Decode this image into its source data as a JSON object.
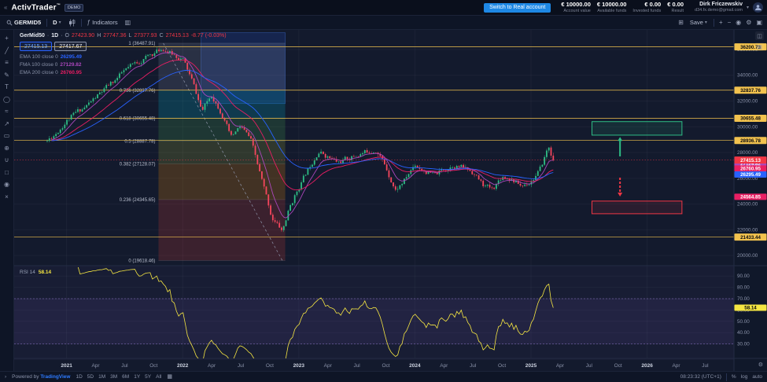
{
  "header": {
    "logo": "ActivTrader",
    "tm": "™",
    "demo_badge": "DEMO",
    "switch_button": "Switch to Real account",
    "metrics": [
      {
        "value": "€ 10000.00",
        "label": "Account value"
      },
      {
        "value": "€ 10000.00",
        "label": "Available funds"
      },
      {
        "value": "€ 0.00",
        "label": "Invested funds"
      },
      {
        "value": "€ 0.00",
        "label": "Result"
      }
    ],
    "user": {
      "name": "Dirk Friczewskiv",
      "detail": "d34.fx.demo@gmail.com"
    }
  },
  "toolbar": {
    "symbol": "GERMID5",
    "interval": "D",
    "indicators_label": "Indicators",
    "save_label": "Save"
  },
  "icons": {
    "chevrons_left": "«",
    "chevron_right": "›",
    "caret": "▾",
    "fx": "ƒ",
    "grid": "▥",
    "layout": "⊞",
    "zoom_in": "+",
    "zoom_out": "−",
    "camera": "◉",
    "settings": "⚙",
    "fullscreen": "▣",
    "calendar": "▦",
    "panel1": "◫",
    "panel2": "▤"
  },
  "drawing_tools": [
    {
      "name": "crosshair-tool",
      "glyph": "+"
    },
    {
      "name": "trendline-tool",
      "glyph": "╱"
    },
    {
      "name": "fib-retracement-tool",
      "glyph": "≡"
    },
    {
      "name": "brush-tool",
      "glyph": "✎"
    },
    {
      "name": "text-tool",
      "glyph": "T"
    },
    {
      "name": "shapes-tool",
      "glyph": "◯"
    },
    {
      "name": "pattern-tool",
      "glyph": "≈"
    },
    {
      "name": "forecast-tool",
      "glyph": "↗"
    },
    {
      "name": "measure-tool",
      "glyph": "▭"
    },
    {
      "name": "zoom-tool",
      "glyph": "⊕"
    },
    {
      "name": "magnet-tool",
      "glyph": "∪"
    },
    {
      "name": "lock-tool",
      "glyph": "□"
    },
    {
      "name": "eye-tool",
      "glyph": "◉"
    },
    {
      "name": "trash-tool",
      "glyph": "×"
    }
  ],
  "legend": {
    "symbol": "GerMid50",
    "sep": "·",
    "interval": "1D",
    "o_label": "O",
    "o": "27423.90",
    "h_label": "H",
    "h": "27747.36",
    "l_label": "L",
    "l": "27377.93",
    "c_label": "C",
    "c": "27415.13",
    "change": "-8.77 (-0.03%)"
  },
  "quotes": {
    "sell": "27415.13",
    "buy": "27417.67"
  },
  "ma_legend": [
    {
      "label": "EMA 100 close 0",
      "value": "26295.49",
      "color": "#2962ff"
    },
    {
      "label": "FMA 100 close 0",
      "value": "27129.82",
      "color": "#ab47bc"
    },
    {
      "label": "EMA 200 close 0",
      "value": "26760.95",
      "color": "#e91e63"
    }
  ],
  "rsi_legend": {
    "label": "RSI 14",
    "value": "58.14"
  },
  "bottom": {
    "powered_prefix": "Powered by",
    "powered_brand": "TradingView",
    "ranges": [
      "1D",
      "5D",
      "1M",
      "3M",
      "6M",
      "1Y",
      "5Y",
      "All"
    ],
    "clock": "08:23:32 (UTC+1)",
    "percent": "%",
    "log": "log",
    "auto": "auto"
  },
  "chart_data": {
    "type": "candlestick",
    "symbol": "GerMid50",
    "interval": "1D",
    "price_axis": {
      "min": 19400,
      "max": 37400,
      "ticks": [
        36000,
        34000,
        32000,
        30000,
        28000,
        26000,
        24000,
        22000,
        20000
      ]
    },
    "time_ticks": [
      {
        "label": "2021",
        "m": 2,
        "year": true
      },
      {
        "label": "Apr",
        "m": 5
      },
      {
        "label": "Jul",
        "m": 8
      },
      {
        "label": "Oct",
        "m": 11
      },
      {
        "label": "2022",
        "m": 14,
        "year": true
      },
      {
        "label": "Apr",
        "m": 17
      },
      {
        "label": "Jul",
        "m": 20
      },
      {
        "label": "Oct",
        "m": 23
      },
      {
        "label": "2023",
        "m": 26,
        "year": true
      },
      {
        "label": "Apr",
        "m": 29
      },
      {
        "label": "Jul",
        "m": 32
      },
      {
        "label": "Oct",
        "m": 35
      },
      {
        "label": "2024",
        "m": 38,
        "year": true
      },
      {
        "label": "Apr",
        "m": 41
      },
      {
        "label": "Jul",
        "m": 44
      },
      {
        "label": "Oct",
        "m": 47
      },
      {
        "label": "2025",
        "m": 50,
        "year": true
      },
      {
        "label": "Apr",
        "m": 53
      },
      {
        "label": "Jul",
        "m": 56
      },
      {
        "label": "Oct",
        "m": 59
      },
      {
        "label": "2026",
        "m": 62,
        "year": true
      },
      {
        "label": "Apr",
        "m": 65
      },
      {
        "label": "Jul",
        "m": 68
      }
    ],
    "anchors": [
      [
        0,
        28900
      ],
      [
        1,
        29600
      ],
      [
        2,
        30500
      ],
      [
        4,
        31600
      ],
      [
        6,
        32900
      ],
      [
        8,
        34300
      ],
      [
        10,
        35300
      ],
      [
        12,
        36100
      ],
      [
        13,
        35600
      ],
      [
        14,
        35300
      ],
      [
        15,
        33500
      ],
      [
        16,
        31200
      ],
      [
        17,
        32500
      ],
      [
        18,
        31200
      ],
      [
        19,
        29100
      ],
      [
        20,
        30000
      ],
      [
        21,
        29000
      ],
      [
        22,
        26300
      ],
      [
        23.2,
        23000
      ],
      [
        24.3,
        21900
      ],
      [
        25,
        23600
      ],
      [
        26,
        25300
      ],
      [
        28,
        28200
      ],
      [
        30,
        27200
      ],
      [
        32,
        27800
      ],
      [
        34,
        28300
      ],
      [
        35,
        26900
      ],
      [
        36,
        25100
      ],
      [
        37,
        25900
      ],
      [
        38,
        27100
      ],
      [
        40,
        26200
      ],
      [
        42,
        27100
      ],
      [
        44,
        26500
      ],
      [
        45,
        25500
      ],
      [
        46,
        25100
      ],
      [
        47,
        26200
      ],
      [
        48,
        26000
      ],
      [
        49,
        25400
      ],
      [
        50,
        25800
      ],
      [
        51,
        26700
      ],
      [
        51.8,
        28500
      ],
      [
        52.3,
        27415.13
      ]
    ],
    "candles": {
      "count": 232,
      "end_m": 52.3,
      "seed": 11
    },
    "up_color": "#2ebd85",
    "down_color": "#f6465d",
    "moving_averages": [
      {
        "name": "FMA",
        "span": 8,
        "color": "#ab47bc"
      },
      {
        "name": "EMA 200",
        "span": 24,
        "color": "#e91e63"
      },
      {
        "name": "EMA 100",
        "span": 44,
        "color": "#2962ff"
      }
    ],
    "current_price": {
      "value": 27415.13,
      "color": "#f23645"
    },
    "ma_badges": [
      {
        "value": 27129.82,
        "color": "#ab47bc"
      },
      {
        "value": 26760.95,
        "color": "#e91e63"
      },
      {
        "value": 26295.49,
        "color": "#2962ff"
      }
    ],
    "hlines": {
      "color": "#f2c24e",
      "values": [
        36200.73,
        32837.76,
        30655.48,
        28936.78,
        21433.44
      ]
    },
    "fib": {
      "m1": 11.5,
      "m2": 24.6,
      "trend_from": {
        "m": 12,
        "price": 36487.91
      },
      "trend_to": {
        "m": 24.3,
        "price": 19618.46
      },
      "levels": [
        {
          "ratio": "1",
          "price": 36487.91,
          "label": "1 (36487.91)"
        },
        {
          "ratio": "0.786",
          "price": 32837.76,
          "label": "0.786 (32837.76)"
        },
        {
          "ratio": "0.618",
          "price": 30655.48,
          "label": "0.618 (30655.48)"
        },
        {
          "ratio": "0.5",
          "price": 28887.78,
          "label": "0.5 (28887.78)"
        },
        {
          "ratio": "0.382",
          "price": 27128.07,
          "label": "0.382 (27128.07)"
        },
        {
          "ratio": "0.236",
          "price": 24345.65,
          "label": "0.236 (24345.65)"
        },
        {
          "ratio": "0",
          "price": 19618.46,
          "label": "0 (19618.46)"
        }
      ],
      "band_colors": [
        "rgba(159,168,190,0.16)",
        "rgba(0,188,212,0.20)",
        "rgba(76,175,80,0.20)",
        "rgba(205,220,57,0.16)",
        "rgba(255,152,0,0.20)",
        "rgba(244,67,54,0.18)"
      ]
    },
    "range_box": {
      "m1": 15.9,
      "m2": 24.6,
      "p1": 37300,
      "p2": 31800,
      "fill": "rgba(41,98,255,0.16)",
      "stroke": "rgba(73,133,255,0.5)"
    },
    "zones": [
      {
        "m1": 56.3,
        "m2": 65.6,
        "p1": 30400,
        "p2": 29350,
        "stroke": "#2ebd85",
        "fill": "rgba(46,189,133,0.12)",
        "badge": null
      },
      {
        "m1": 56.3,
        "m2": 65.6,
        "p1": 24230,
        "p2": 23250,
        "stroke": "#f23645",
        "fill": "rgba(242,54,69,0.10)",
        "badge": {
          "value": 24564.85,
          "color": "#e91e63"
        }
      }
    ],
    "arrows": [
      {
        "m": 59.2,
        "from": 27700,
        "to": 29150,
        "color": "#2ebd85",
        "dash": false
      },
      {
        "m": 59.2,
        "from": 26050,
        "to": 24650,
        "color": "#f23645",
        "dash": true
      }
    ],
    "rsi": {
      "period": 14,
      "color": "#f5e642",
      "ticks": [
        90,
        80,
        70,
        60,
        50,
        40,
        30
      ],
      "upper": 70,
      "lower": 30,
      "min": 20,
      "max": 95,
      "value_label": "58.14",
      "band_fill": "rgba(126,87,194,0.10)",
      "band_line": "#8f76c9"
    }
  }
}
